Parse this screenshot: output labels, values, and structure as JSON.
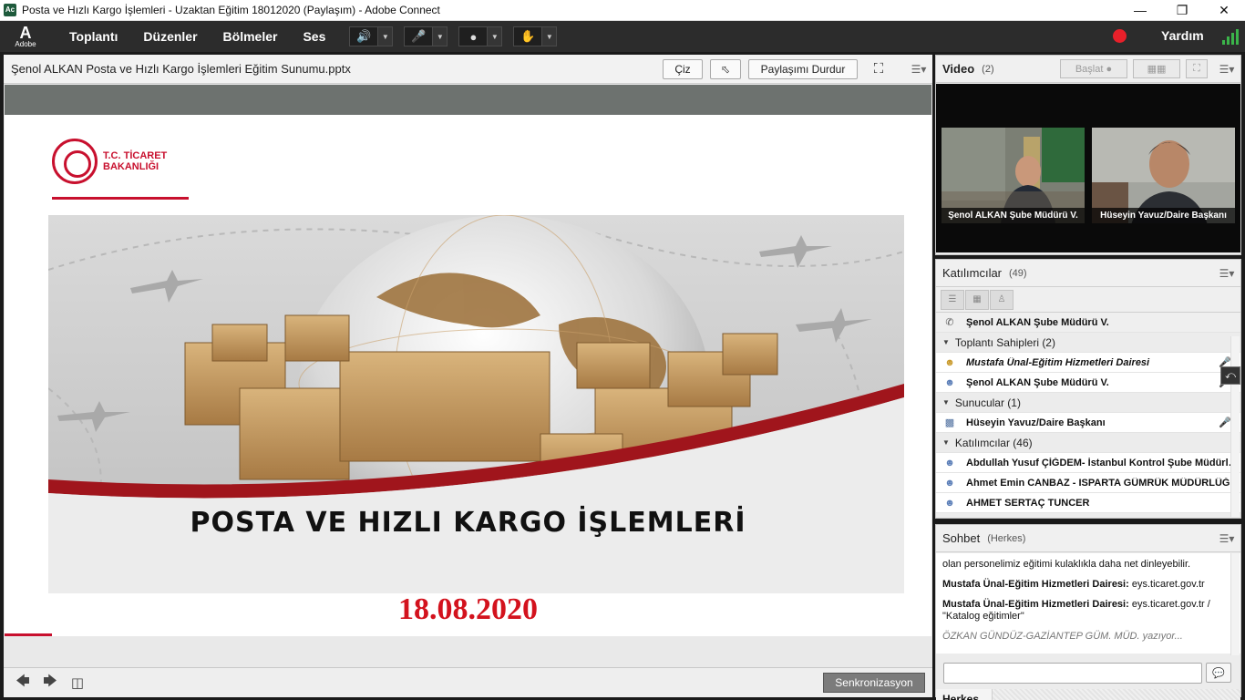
{
  "window": {
    "title": "Posta ve Hızlı Kargo İşlemleri - Uzaktan Eğitim 18012020 (Paylaşım) - Adobe Connect",
    "minimize": "—",
    "maximize": "❐",
    "close": "✕"
  },
  "menubar": {
    "logo_mark": "A",
    "logo_text": "Adobe",
    "items": [
      "Toplantı",
      "Düzenler",
      "Bölmeler",
      "Ses"
    ],
    "help": "Yardım",
    "colors": {
      "speaker_active": "#2ecc40",
      "record": "#e8202a",
      "signal": "#3bb44a"
    }
  },
  "share_pod": {
    "title": "Şenol ALKAN Posta ve Hızlı Kargo İşlemleri Eğitim Sunumu.pptx",
    "draw_button": "Çiz",
    "stop_sharing_button": "Paylaşımı Durdur",
    "sync_button": "Senkronizasyon",
    "slide": {
      "logo_line1": "T.C. TİCARET",
      "logo_line2": "BAKANLIĞI",
      "title": "POSTA VE HIZLI KARGO İŞLEMLERİ",
      "date": "18.08.2020",
      "accent_color": "#c8102e"
    }
  },
  "video_pod": {
    "title": "Video",
    "count": "(2)",
    "start_button": "Başlat",
    "feeds": [
      {
        "label": "Şenol ALKAN Şube Müdürü V."
      },
      {
        "label": "Hüseyin Yavuz/Daire Başkanı"
      }
    ]
  },
  "attendees_pod": {
    "title": "Katılımcılar",
    "count": "(49)",
    "current_speaker": "Şenol ALKAN Şube Müdürü V.",
    "groups": [
      {
        "name": "Toplantı Sahipleri (2)",
        "members": [
          "Mustafa Ünal-Eğitim Hizmetleri Dairesi",
          "Şenol ALKAN Şube Müdürü V."
        ]
      },
      {
        "name": "Sunucular (1)",
        "members": [
          "Hüseyin Yavuz/Daire Başkanı"
        ]
      },
      {
        "name": "Katılımcılar (46)",
        "members": [
          "Abdullah Yusuf ÇİĞDEM- İstanbul Kontrol Şube Müdürlüğü",
          "Ahmet Emin CANBAZ - ISPARTA GÜMRÜK MÜDÜRLÜĞÜ",
          "AHMET SERTAÇ TUNCER"
        ]
      }
    ]
  },
  "chat_pod": {
    "title": "Sohbet",
    "scope": "(Herkes)",
    "messages": [
      {
        "author": "",
        "text": "olan personelimiz eğitimi kulaklıkla daha net dinleyebilir."
      },
      {
        "author": "Mustafa Ünal-Eğitim Hizmetleri Dairesi:",
        "text": " eys.ticaret.gov.tr"
      },
      {
        "author": "Mustafa Ünal-Eğitim Hizmetleri Dairesi:",
        "text": " eys.ticaret.gov.tr / \"Katalog eğitimler\""
      }
    ],
    "typing": "ÖZKAN GÜNDÜZ-GAZİANTEP GÜM. MÜD. yazıyor...",
    "input_value": "",
    "tab": "Herkes"
  }
}
